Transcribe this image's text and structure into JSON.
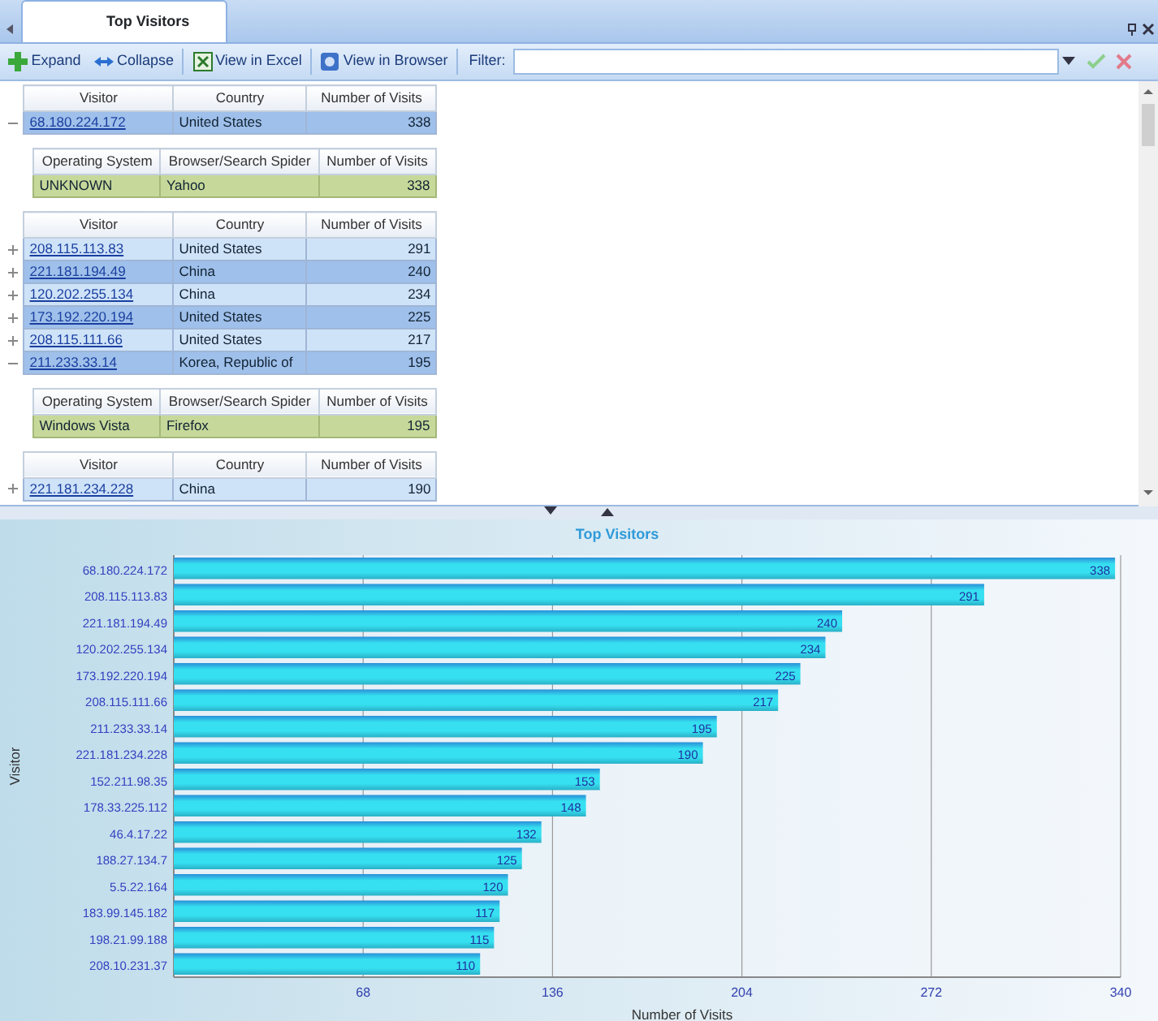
{
  "window": {
    "tab": {
      "label": "Top Visitors",
      "selected": true
    }
  },
  "toolbar": {
    "buttons": [
      {
        "label": "Expand",
        "kind": "expand"
      },
      {
        "label": "Collapse",
        "kind": "collapse"
      },
      {
        "label": "View in Excel",
        "kind": "excel"
      },
      {
        "label": "View in Browser",
        "kind": "browser"
      }
    ],
    "filter": {
      "label": "Filter:"
    }
  },
  "grid": {
    "groups": [
      {
        "columns": [
          "Visitor",
          "Country",
          "Number of Visits"
        ],
        "rows": [
          {
            "visitor": "68.180.224.172",
            "country": "United States",
            "visits": "338",
            "expanded": true,
            "detail": {
              "columns": [
                "Operating System",
                "Browser/Search Spider",
                "Number of Visits"
              ],
              "rows": [
                [
                  "UNKNOWN",
                  "Yahoo",
                  "338"
                ]
              ]
            }
          }
        ]
      },
      {
        "columns": [
          "Visitor",
          "Country",
          "Number of Visits"
        ],
        "rows": [
          {
            "visitor": "208.115.113.83",
            "country": "United States",
            "visits": "291",
            "expanded": false
          },
          {
            "visitor": "221.181.194.49",
            "country": "China",
            "visits": "240",
            "expanded": false
          },
          {
            "visitor": "120.202.255.134",
            "country": "China",
            "visits": "234",
            "expanded": false
          },
          {
            "visitor": "173.192.220.194",
            "country": "United States",
            "visits": "225",
            "expanded": false
          },
          {
            "visitor": "208.115.111.66",
            "country": "United States",
            "visits": "217",
            "expanded": false
          },
          {
            "visitor": "211.233.33.14",
            "country": "Korea, Republic of",
            "visits": "195",
            "expanded": true,
            "detail": {
              "columns": [
                "Operating System",
                "Browser/Search Spider",
                "Number of Visits"
              ],
              "rows": [
                [
                  "Windows Vista",
                  "Firefox",
                  "195"
                ]
              ]
            }
          }
        ]
      },
      {
        "columns": [
          "Visitor",
          "Country",
          "Number of Visits"
        ],
        "rows": [
          {
            "visitor": "221.181.234.228",
            "country": "China",
            "visits": "190",
            "expanded": false
          }
        ]
      }
    ]
  },
  "chart": {
    "chart_data": {
      "type": "bar",
      "orientation": "horizontal",
      "title": "Top Visitors",
      "xlabel": "Number of Visits",
      "ylabel": "Visitor",
      "categories": [
        "68.180.224.172",
        "208.115.113.83",
        "221.181.194.49",
        "120.202.255.134",
        "173.192.220.194",
        "208.115.111.66",
        "211.233.33.14",
        "221.181.234.228",
        "152.211.98.35",
        "178.33.225.112",
        "46.4.17.22",
        "188.27.134.7",
        "5.5.22.164",
        "183.99.145.182",
        "198.21.99.188",
        "208.10.231.37"
      ],
      "series": [
        {
          "color": "#36e0f0",
          "values": [
            338,
            291,
            240,
            234,
            225,
            217,
            195,
            190,
            153,
            148,
            132,
            125,
            120,
            117,
            115,
            110
          ]
        }
      ],
      "grid": true,
      "xlim": [
        0,
        340
      ],
      "xticks": [
        68,
        136,
        204,
        272,
        340
      ],
      "data_labels": true
    }
  }
}
